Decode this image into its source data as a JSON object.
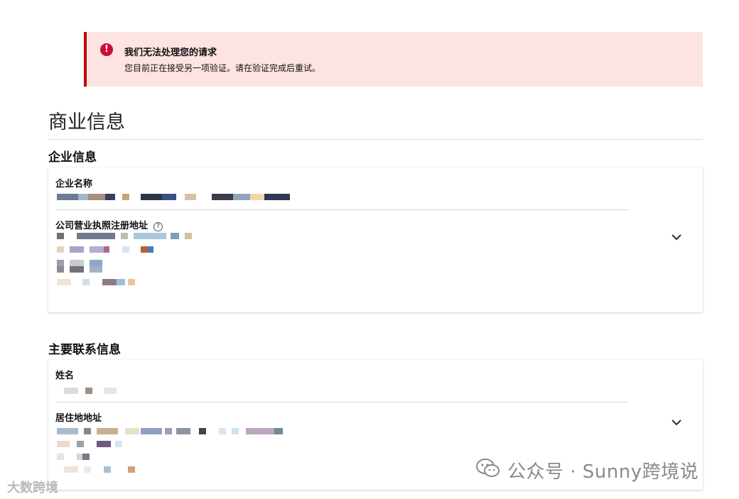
{
  "alert": {
    "title": "我们无法处理您的请求",
    "message": "您目前正在接受另一项验证。请在验证完成后重试。",
    "icon": "error-icon",
    "accent": "#c40000"
  },
  "page_title": "商业信息",
  "business_section": {
    "title": "企业信息",
    "company_name_label": "企业名称",
    "registered_address_label": "公司营业执照注册地址",
    "help_glyph": "?"
  },
  "contact_section": {
    "title": "主要联系信息",
    "name_label": "姓名",
    "residential_address_label": "居住地地址"
  },
  "watermark": {
    "primary": "公众号 · Sunny跨境说",
    "secondary": "大数跨境"
  }
}
